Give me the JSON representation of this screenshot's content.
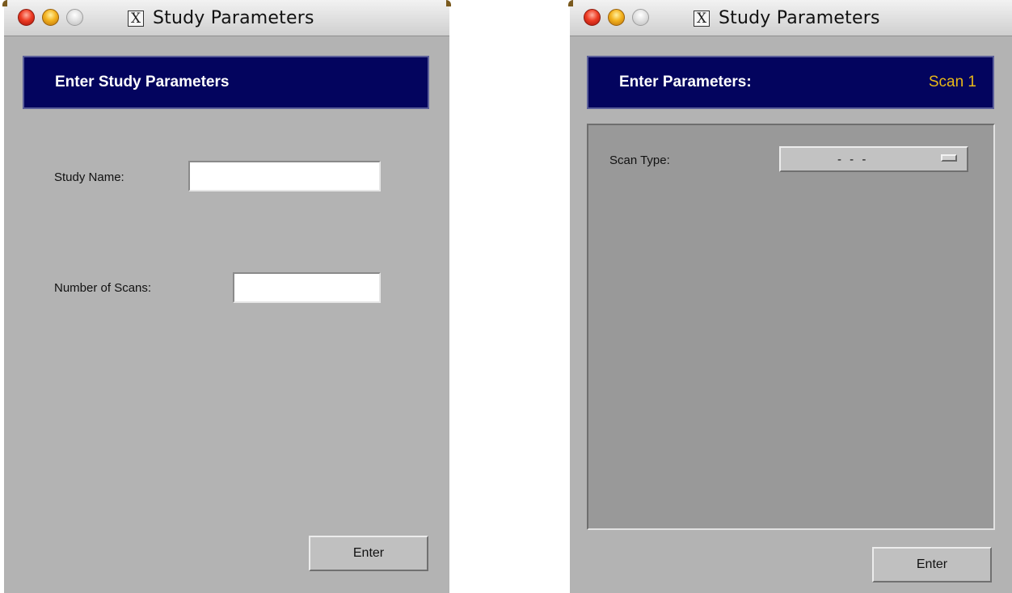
{
  "window1": {
    "title": "Study Parameters",
    "title_icon": "X",
    "banner": "Enter Study Parameters",
    "fields": [
      {
        "label": "Study Name:",
        "value": ""
      },
      {
        "label": "Number of Scans:",
        "value": ""
      }
    ],
    "enter_label": "Enter"
  },
  "window2": {
    "title": "Study Parameters",
    "title_icon": "X",
    "banner": "Enter Parameters:",
    "banner_scan": "Scan 1",
    "scan_type_label": "Scan Type:",
    "scan_type_value": "- - -",
    "enter_label": "Enter"
  },
  "colors": {
    "banner_bg": "#03045e",
    "banner_scan_text": "#e8b818",
    "window_bg": "#b3b3b3",
    "panel_bg": "#999999"
  },
  "icons": [
    "close-traffic-light",
    "minimize-traffic-light",
    "zoom-traffic-light",
    "x11-icon",
    "dropdown-indicator-icon"
  ]
}
